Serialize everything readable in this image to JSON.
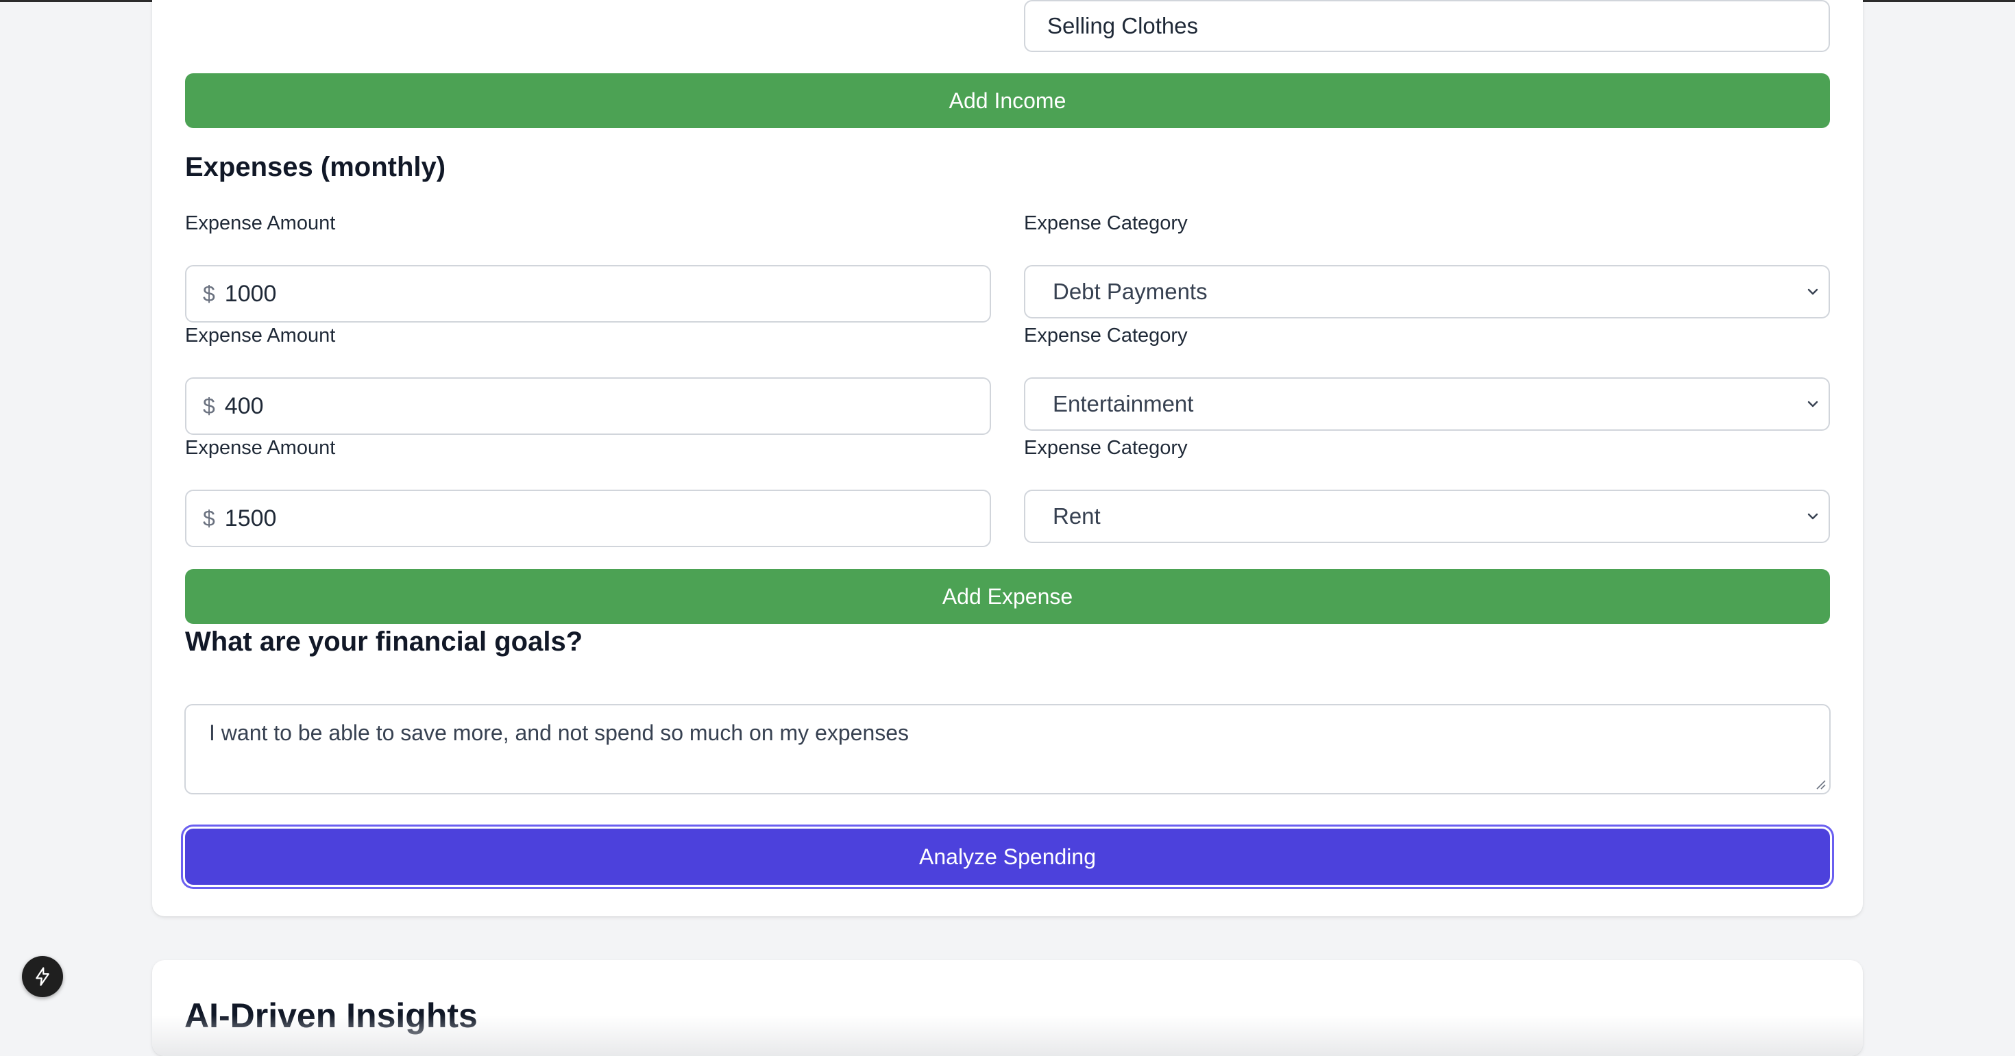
{
  "income_form": {
    "source_value": "Selling Clothes",
    "add_income_label": "Add Income"
  },
  "expenses": {
    "title": "Expenses (monthly)",
    "amount_label": "Expense Amount",
    "category_label": "Expense Category",
    "currency_symbol": "$",
    "rows": [
      {
        "amount": "1000",
        "category": "Debt Payments"
      },
      {
        "amount": "400",
        "category": "Entertainment"
      },
      {
        "amount": "1500",
        "category": "Rent"
      }
    ],
    "add_expense_label": "Add Expense"
  },
  "goals": {
    "title": "What are your financial goals?",
    "text": "I want to be able to save more, and not spend so much on my expenses"
  },
  "analyze_label": "Analyze Spending",
  "insights": {
    "title": "AI-Driven Insights"
  },
  "colors": {
    "green_button": "#4ca254",
    "analyze_button": "#4c41dc",
    "page_background": "#f3f4f6",
    "card_background": "#ffffff"
  },
  "icons": {
    "select_arrow": "chevron-down-icon",
    "floating_button": "lightning-bolt-icon",
    "textarea_resize": "resize-handle-icon"
  }
}
